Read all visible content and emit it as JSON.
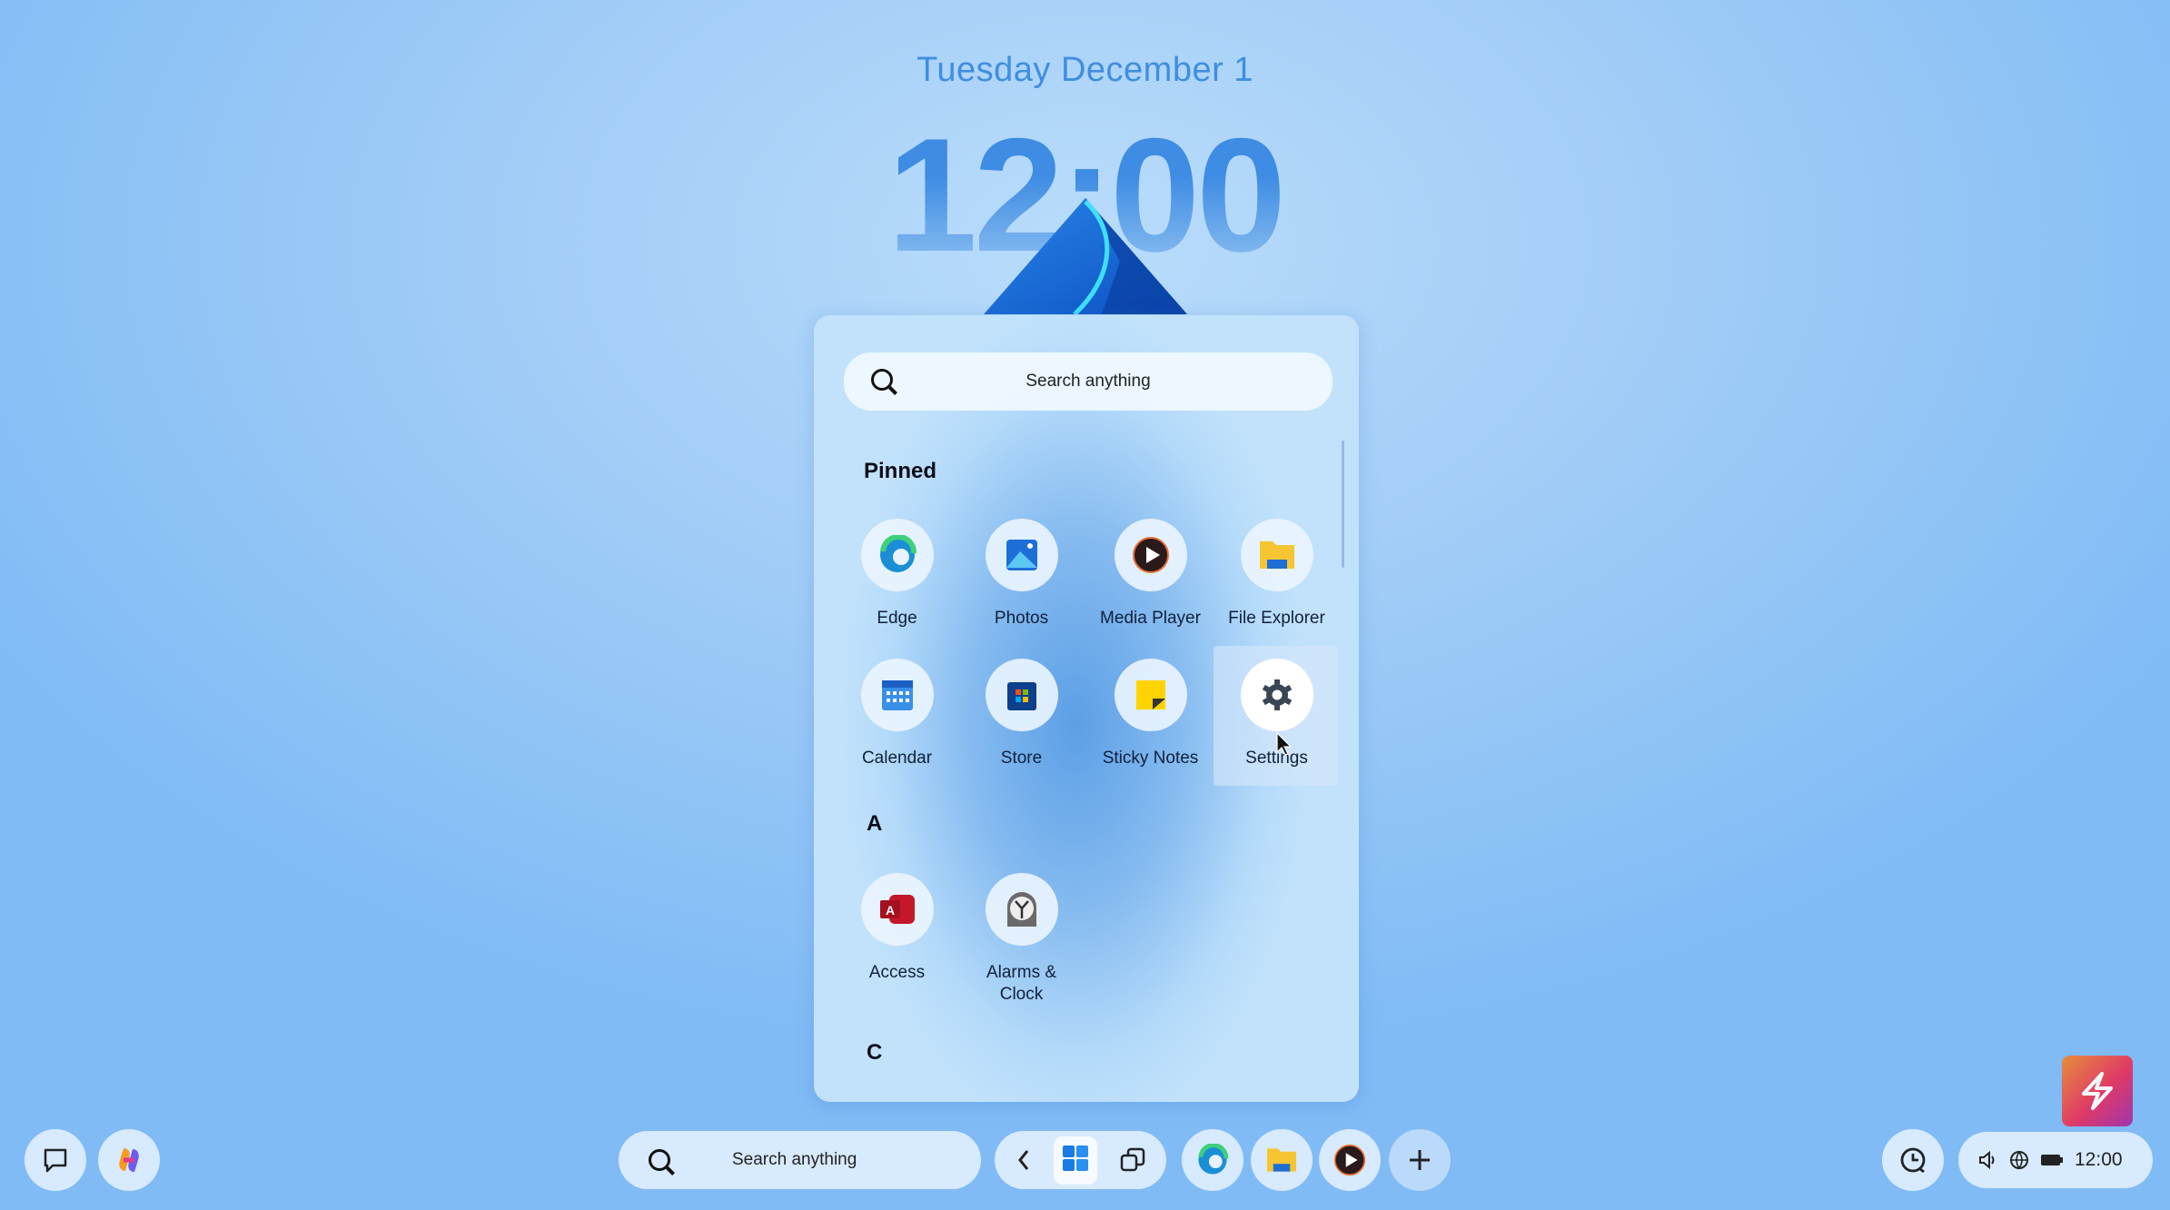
{
  "lockscreen": {
    "date": "Tuesday December 1",
    "time": "12:00"
  },
  "start": {
    "search_placeholder": "Search anything",
    "pinned_label": "Pinned",
    "pinned": [
      {
        "label": "Edge",
        "icon": "edge-icon"
      },
      {
        "label": "Photos",
        "icon": "photos-icon"
      },
      {
        "label": "Media Player",
        "icon": "media-player-icon"
      },
      {
        "label": "File Explorer",
        "icon": "folder-icon"
      },
      {
        "label": "Calendar",
        "icon": "calendar-icon"
      },
      {
        "label": "Store",
        "icon": "store-icon"
      },
      {
        "label": "Sticky Notes",
        "icon": "sticky-notes-icon"
      },
      {
        "label": "Settings",
        "icon": "gear-icon"
      }
    ],
    "sections": [
      {
        "letter": "A",
        "apps": [
          {
            "label": "Access",
            "icon": "access-icon"
          },
          {
            "label": "Alarms & Clock",
            "icon": "alarm-clock-icon"
          }
        ]
      },
      {
        "letter": "C",
        "apps": []
      }
    ]
  },
  "taskbar": {
    "search_placeholder": "Search anything",
    "tray_time": "12:00",
    "pinned_apps": [
      "edge-icon",
      "folder-icon",
      "media-player-icon",
      "plus-icon"
    ]
  },
  "colors": {
    "accent": "#3f8ee0",
    "background": "#a2cdf7"
  }
}
